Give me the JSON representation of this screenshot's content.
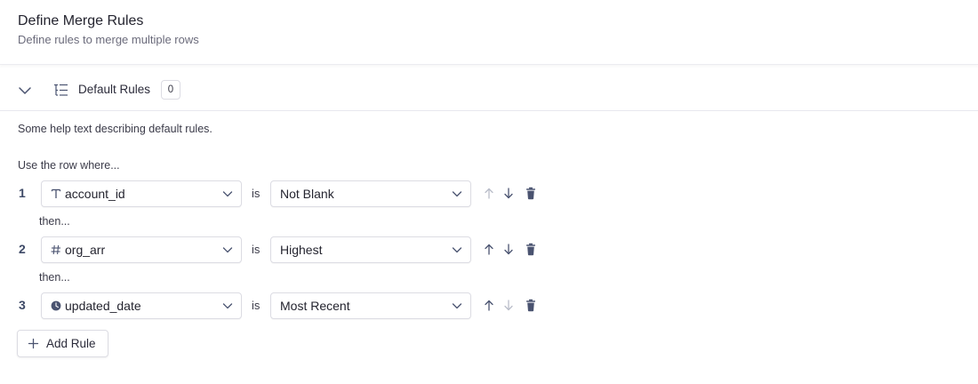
{
  "header": {
    "title": "Define Merge Rules",
    "subtitle": "Define rules to merge multiple rows"
  },
  "section": {
    "title": "Default Rules",
    "count": "0",
    "expanded": true,
    "icons": {
      "toggle": "chevron-down-icon",
      "section": "list-tree-icon"
    },
    "help_text": "Some help text describing default rules.",
    "use_row_label": "Use the row where..."
  },
  "rules": [
    {
      "number": "1",
      "field": "account_id",
      "field_type_icon": "text-type-icon",
      "is_label": "is",
      "condition": "Not Blank",
      "move_up_enabled": false,
      "move_down_enabled": true
    },
    {
      "number": "2",
      "field": "org_arr",
      "field_type_icon": "number-type-icon",
      "is_label": "is",
      "condition": "Highest",
      "move_up_enabled": true,
      "move_down_enabled": true
    },
    {
      "number": "3",
      "field": "updated_date",
      "field_type_icon": "clock-type-icon",
      "is_label": "is",
      "condition": "Most Recent",
      "move_up_enabled": true,
      "move_down_enabled": false
    }
  ],
  "then_labels": [
    "then...",
    "then..."
  ],
  "add_rule_label": "Add Rule",
  "colors": {
    "icon_enabled": "#4a5370",
    "icon_disabled": "#b9bdc9",
    "rule_number": "#3e4a67",
    "border": "#dcdce3"
  }
}
